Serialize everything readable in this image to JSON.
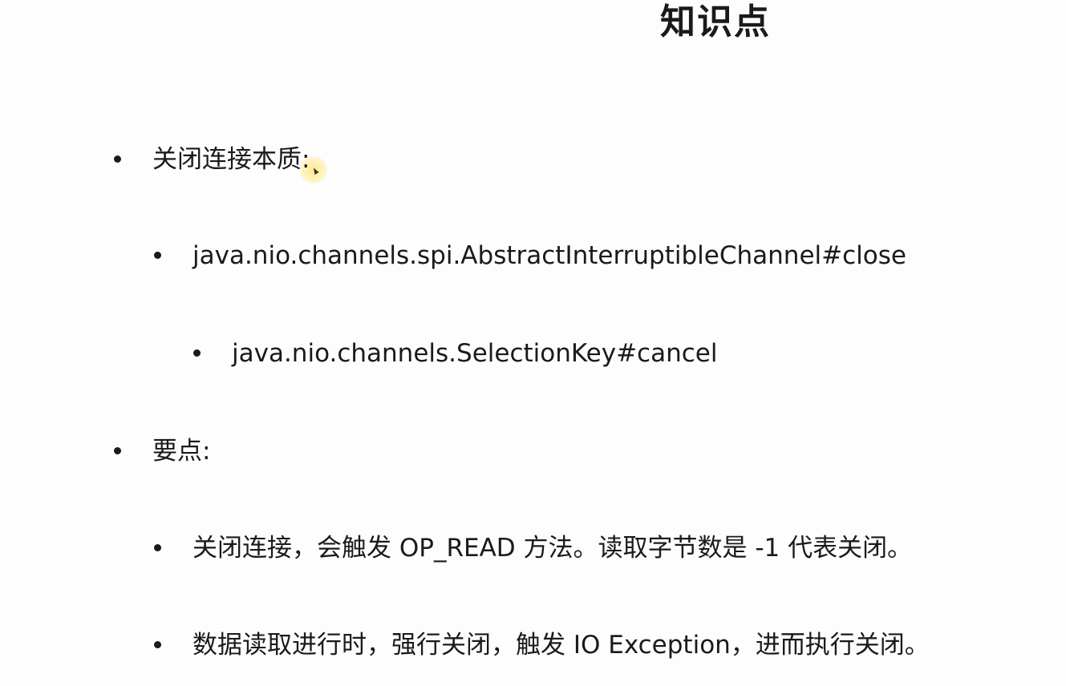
{
  "title": "知识点",
  "items": [
    {
      "level": 1,
      "text": "关闭连接本质:"
    },
    {
      "level": 2,
      "text": "java.nio.channels.spi.AbstractInterruptibleChannel#close"
    },
    {
      "level": 3,
      "text": "java.nio.channels.SelectionKey#cancel"
    },
    {
      "level": 1,
      "text": "要点:"
    },
    {
      "level": 2,
      "text": "关闭连接，会触发 OP_READ 方法。读取字节数是 -1 代表关闭。"
    },
    {
      "level": 2,
      "text": "数据读取进行时，强行关闭，触发 IO Exception，进而执行关闭。"
    }
  ]
}
